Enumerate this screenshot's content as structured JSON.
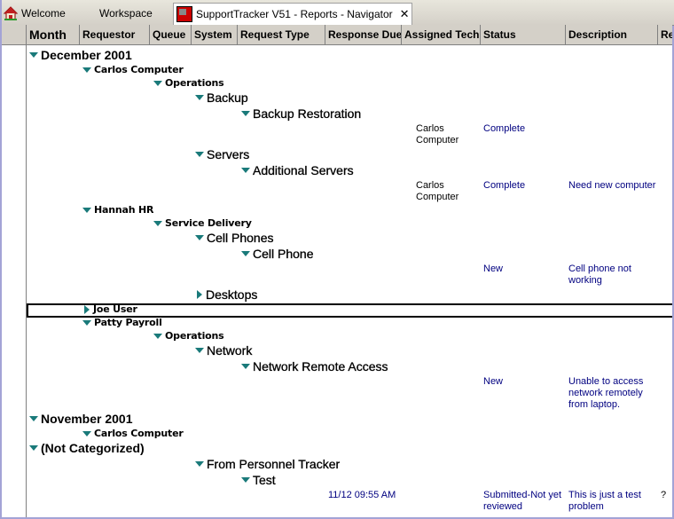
{
  "tabs": [
    {
      "label": "Welcome",
      "icon": "home-icon"
    },
    {
      "label": "Workspace"
    },
    {
      "label": "SupportTracker V51 - Reports - Navigator",
      "icon": "app-icon",
      "active": true,
      "close": "✕"
    }
  ],
  "columns": [
    "Month",
    "Requestor",
    "Queue",
    "System",
    "Request Type",
    "Response Due",
    "Assigned Tech",
    "Status",
    "Description",
    "Re"
  ],
  "tree": [
    {
      "label": "December 2001",
      "level": 0,
      "expanded": true
    },
    {
      "label": "Carlos Computer",
      "level": 1,
      "expanded": true
    },
    {
      "label": "Operations",
      "level": 2,
      "expanded": true
    },
    {
      "label": "Backup",
      "level": 3,
      "expanded": true
    },
    {
      "label": "Backup Restoration",
      "level": 4,
      "expanded": true
    },
    {
      "label": "Servers",
      "level": 3,
      "expanded": true
    },
    {
      "label": "Additional Servers",
      "level": 4,
      "expanded": true
    },
    {
      "label": "Hannah HR",
      "level": 1,
      "expanded": true
    },
    {
      "label": "Service Delivery",
      "level": 2,
      "expanded": true
    },
    {
      "label": "Cell Phones",
      "level": 3,
      "expanded": true
    },
    {
      "label": "Cell Phone",
      "level": 4,
      "expanded": true
    },
    {
      "label": "Desktops",
      "level": 3,
      "expanded": false
    },
    {
      "label": "Joe User",
      "level": 1,
      "expanded": false,
      "selected": true
    },
    {
      "label": "Patty Payroll",
      "level": 1,
      "expanded": true
    },
    {
      "label": "Operations",
      "level": 2,
      "expanded": true
    },
    {
      "label": "Network",
      "level": 3,
      "expanded": true
    },
    {
      "label": "Network Remote Access",
      "level": 4,
      "expanded": true
    },
    {
      "label": "November 2001",
      "level": 0,
      "expanded": true
    },
    {
      "label": "Carlos Computer",
      "level": 1,
      "expanded": true
    },
    {
      "label": "(Not Categorized)",
      "level": 0,
      "expanded": true
    },
    {
      "label": "From Personnel Tracker",
      "level": 3,
      "expanded": true
    },
    {
      "label": "Test",
      "level": 4,
      "expanded": true
    }
  ],
  "records": [
    {
      "assigned_tech": "Carlos\nComputer",
      "status": "Complete",
      "description": ""
    },
    {
      "assigned_tech": "Carlos\nComputer",
      "status": "Complete",
      "description": "Need new computer"
    },
    {
      "status": "New",
      "description": "Cell phone not\nworking"
    },
    {
      "status": "New",
      "description": "Unable to access\nnetwork remotely\nfrom laptop."
    },
    {
      "response_due": "11/12 09:55 AM",
      "status": "Submitted-Not yet\nreviewed",
      "description": "This is just a test\nproblem",
      "re": "?"
    }
  ]
}
